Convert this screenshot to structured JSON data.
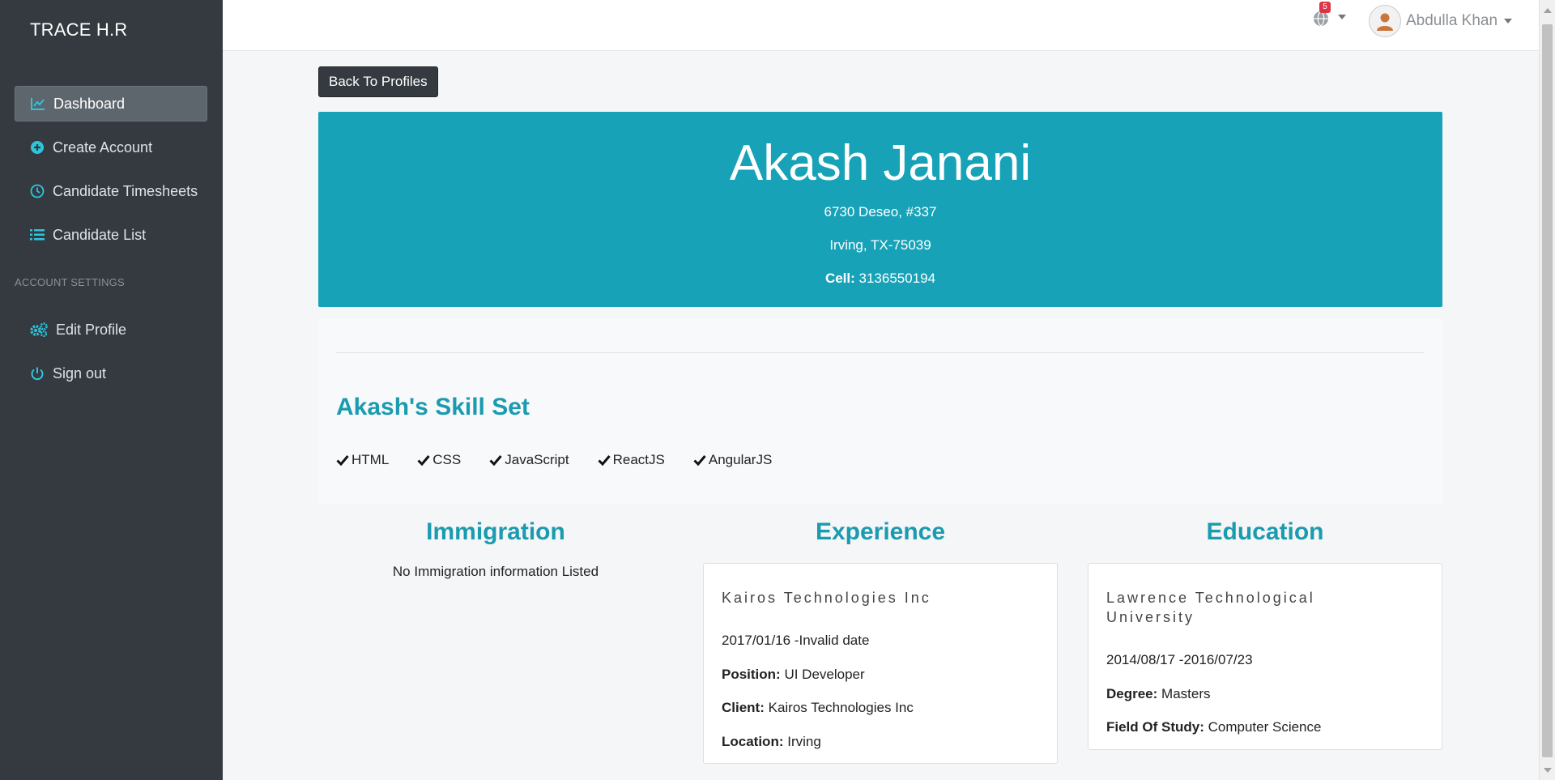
{
  "sidebar": {
    "brand": "TRACE H.R",
    "items": [
      {
        "label": "Dashboard",
        "icon": "chart-line-icon"
      },
      {
        "label": "Create Account",
        "icon": "plus-circle-icon"
      },
      {
        "label": "Candidate Timesheets",
        "icon": "clock-icon"
      },
      {
        "label": "Candidate List",
        "icon": "list-icon"
      }
    ],
    "section_title": "ACCOUNT SETTINGS",
    "settings_items": [
      {
        "label": "Edit Profile",
        "icon": "gears-icon"
      },
      {
        "label": "Sign out",
        "icon": "power-icon"
      }
    ]
  },
  "topbar": {
    "notification_count": "5",
    "user_name": "Abdulla Khan"
  },
  "back_button": "Back To Profiles",
  "profile": {
    "name": "Akash Janani",
    "address_line1": "6730 Deseo, #337",
    "address_line2": "Irving, TX-75039",
    "cell_label": "Cell:",
    "cell_value": " 3136550194"
  },
  "skills": {
    "title": "Akash's Skill Set",
    "items": [
      "HTML",
      "CSS",
      "JavaScript",
      "ReactJS",
      "AngularJS"
    ]
  },
  "immigration": {
    "title": "Immigration",
    "empty_text": "No Immigration information Listed"
  },
  "experience": {
    "title": "Experience",
    "company": "Kairos Technologies Inc",
    "dates": "2017/01/16 -Invalid date",
    "position_label": "Position:",
    "position_value": " UI Developer",
    "client_label": "Client:",
    "client_value": " Kairos Technologies Inc",
    "location_label": "Location:",
    "location_value": " Irving"
  },
  "education": {
    "title": "Education",
    "school_line1": "Lawrence Technological",
    "school_line2": "University",
    "dates": "2014/08/17 -2016/07/23",
    "degree_label": "Degree:",
    "degree_value": " Masters",
    "field_label": "Field Of Study:",
    "field_value": " Computer Science"
  },
  "colors": {
    "sidebar_bg": "#343a40",
    "accent": "#17a2b8",
    "heading": "#1a9bb0",
    "badge": "#dc3545"
  }
}
